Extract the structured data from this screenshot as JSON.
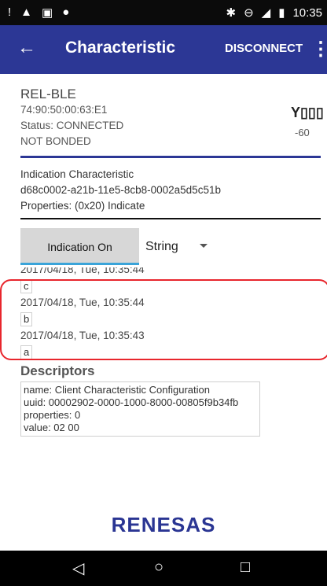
{
  "status_bar": {
    "time": "10:35",
    "left_icons": [
      "alert",
      "warning",
      "sim",
      "android"
    ],
    "right_icons": [
      "bluetooth",
      "minus-circle",
      "signal-off",
      "battery"
    ]
  },
  "appbar": {
    "back": "←",
    "title": "Characteristic",
    "disconnect": "DISCONNECT",
    "more": "⋮"
  },
  "device": {
    "name": "REL-BLE",
    "address": "74:90:50:00:63:E1",
    "status": "Status: CONNECTED",
    "bond": "NOT BONDED",
    "rssi": "-60",
    "signal_icon": "signal-strength-icon"
  },
  "characteristic": {
    "name": "Indication Characteristic",
    "uuid": "d68c0002-a21b-11e5-8cb8-0002a5d5c51b",
    "properties": "Properties: (0x20) Indicate"
  },
  "controls": {
    "indication_button": "Indication On",
    "format_value": "String"
  },
  "log": [
    {
      "time": "2017/04/18, Tue, 10:35:44",
      "value": "c"
    },
    {
      "time": "2017/04/18, Tue, 10:35:44",
      "value": "b"
    },
    {
      "time": "2017/04/18, Tue, 10:35:43",
      "value": "a"
    }
  ],
  "log_partial_top": "2017/04/18, Tue, 10:35:44",
  "descriptors": {
    "title": "Descriptors",
    "lines": [
      "name: Client Characteristic Configuration",
      "uuid: 00002902-0000-1000-8000-00805f9b34fb",
      "properties: 0",
      "value: 02 00"
    ]
  },
  "brand": "RENESAS",
  "nav": {
    "back": "◁",
    "home": "○",
    "recents": "□"
  },
  "colors": {
    "appbar": "#2c3795",
    "accent_line": "#2c3795",
    "button_indicator": "#3aa4d9",
    "highlight": "#e8262d"
  }
}
